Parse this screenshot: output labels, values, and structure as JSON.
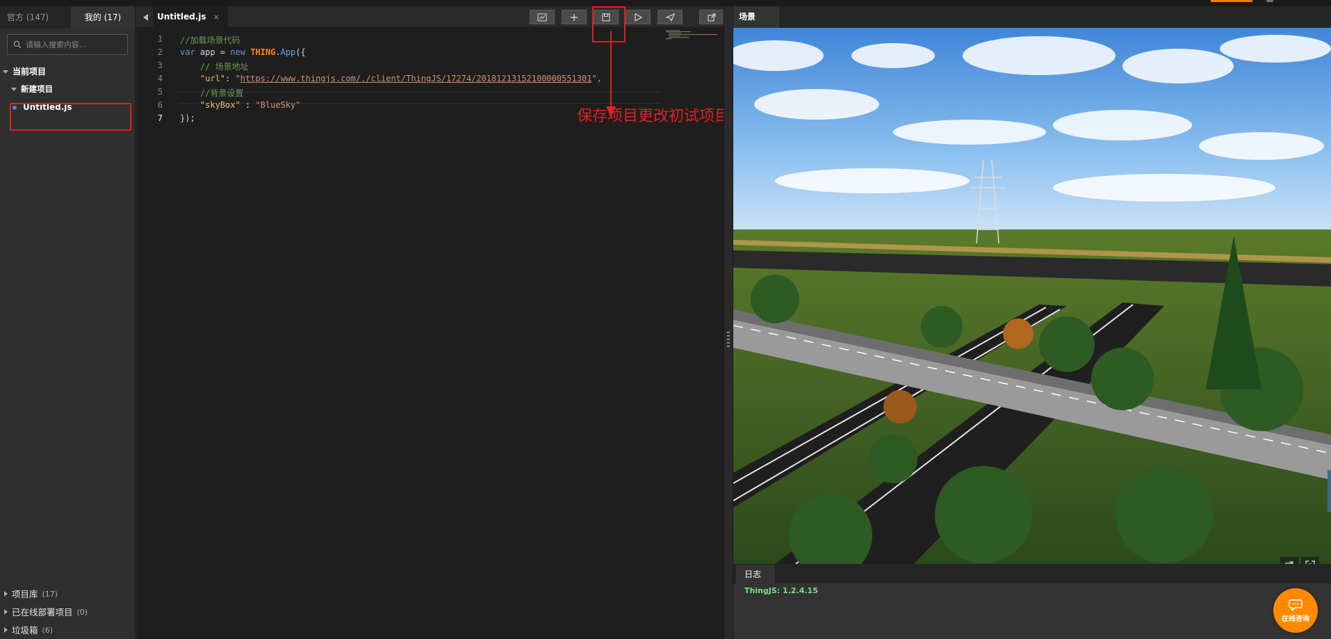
{
  "sidebar": {
    "tabs": [
      {
        "label": "官方 (147)",
        "active": false
      },
      {
        "label": "我的 (17)",
        "active": true
      }
    ],
    "search_placeholder": "请输入搜索内容...",
    "tree": {
      "project_label": "当前项目",
      "folder_label": "新建项目",
      "file_label": "Untitled.js"
    },
    "bottom": [
      {
        "label": "项目库",
        "count": "(17)"
      },
      {
        "label": "已在线部署项目",
        "count": "(0)"
      },
      {
        "label": "垃圾箱",
        "count": "(6)"
      }
    ]
  },
  "editor": {
    "tab_title": "Untitled.js",
    "tab_close": "×",
    "toolbar_icons": [
      "chart-icon",
      "plus-icon",
      "save-icon",
      "play-icon",
      "send-icon",
      "external-link-icon"
    ],
    "line_numbers": [
      "1",
      "2",
      "3",
      "4",
      "5",
      "6",
      "7"
    ],
    "code": {
      "l1_comment": "//加载场景代码",
      "l2_var": "var",
      "l2_mid": " app = ",
      "l2_new": "new",
      "l2_thing": "THING",
      "l2_dot": ".",
      "l2_app": "App",
      "l2_end": "({",
      "l3_comment": "    // 场景地址",
      "l4_indent": "    ",
      "l4_key": "\"url\"",
      "l4_colon": ": ",
      "l4_q1": "\"",
      "l4_url": "https://www.thingjs.com/./client/ThingJS/17274/20181213152100000551301",
      "l4_q2": "\",",
      "l5_comment": "    //背景设置",
      "l6_indent": "    ",
      "l6_key": "\"skyBox\"",
      "l6_colon": " : ",
      "l6_val": "\"BlueSky\"",
      "l7": "});"
    },
    "annotation": "保存项目更改初试项目名进行项目开发"
  },
  "scene": {
    "tab_label": "场景",
    "log_tab_label": "日志",
    "log_line": "ThingJS: 1.2.4.15",
    "chat_label": "在线咨询"
  },
  "colors": {
    "highlight_red": "#e02020",
    "accent_orange": "#ff8a00",
    "log_green": "#7ee08a"
  }
}
